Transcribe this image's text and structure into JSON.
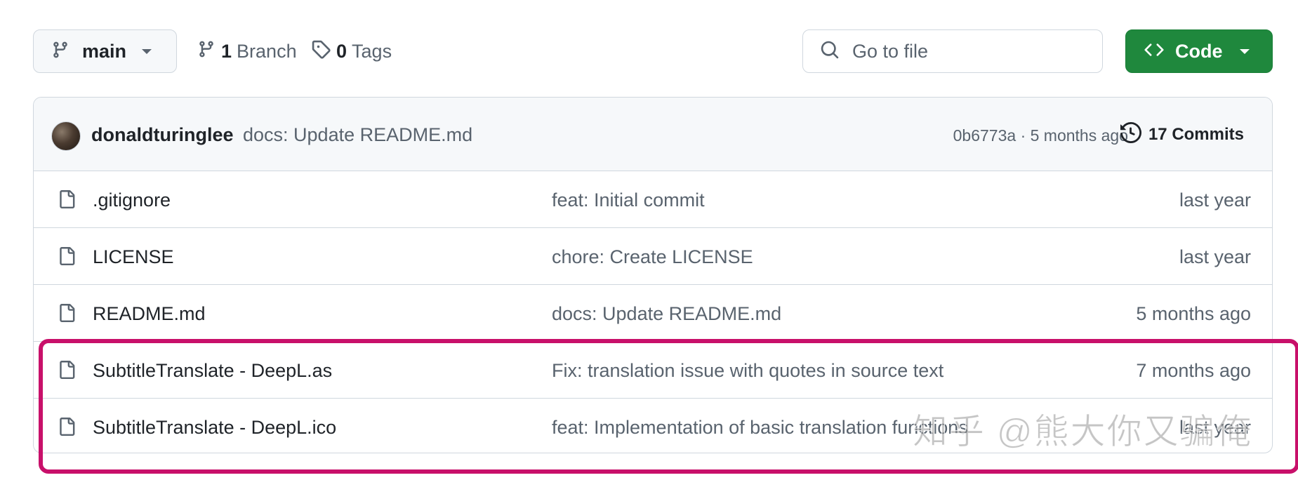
{
  "toolbar": {
    "branch_selector": {
      "label": "main"
    },
    "branches": {
      "count": "1",
      "label": "Branch"
    },
    "tags": {
      "count": "0",
      "label": "Tags"
    },
    "search": {
      "placeholder": "Go to file"
    },
    "code_button": {
      "label": "Code"
    }
  },
  "latest_commit": {
    "author": "donaldturinglee",
    "message": "docs: Update README.md",
    "hash_and_time": "0b6773a · 5 months ago",
    "commits_label": "17 Commits"
  },
  "files": [
    {
      "name": ".gitignore",
      "message": "feat: Initial commit",
      "date": "last year"
    },
    {
      "name": "LICENSE",
      "message": "chore: Create LICENSE",
      "date": "last year"
    },
    {
      "name": "README.md",
      "message": "docs: Update README.md",
      "date": "5 months ago"
    },
    {
      "name": "SubtitleTranslate - DeepL.as",
      "message": "Fix: translation issue with quotes in source text",
      "date": "7 months ago"
    },
    {
      "name": "SubtitleTranslate - DeepL.ico",
      "message": "feat: Implementation of basic translation functions",
      "date": "last year"
    }
  ],
  "watermark": "知乎 @熊大你又骗俺",
  "colors": {
    "code_button": "#1f883d",
    "highlight_border": "#c8106a",
    "border": "#d0d7de",
    "muted_text": "#59636e"
  },
  "icons": [
    "git-branch-icon",
    "chevron-down-icon",
    "tag-icon",
    "search-icon",
    "code-icon",
    "history-icon",
    "file-icon"
  ]
}
